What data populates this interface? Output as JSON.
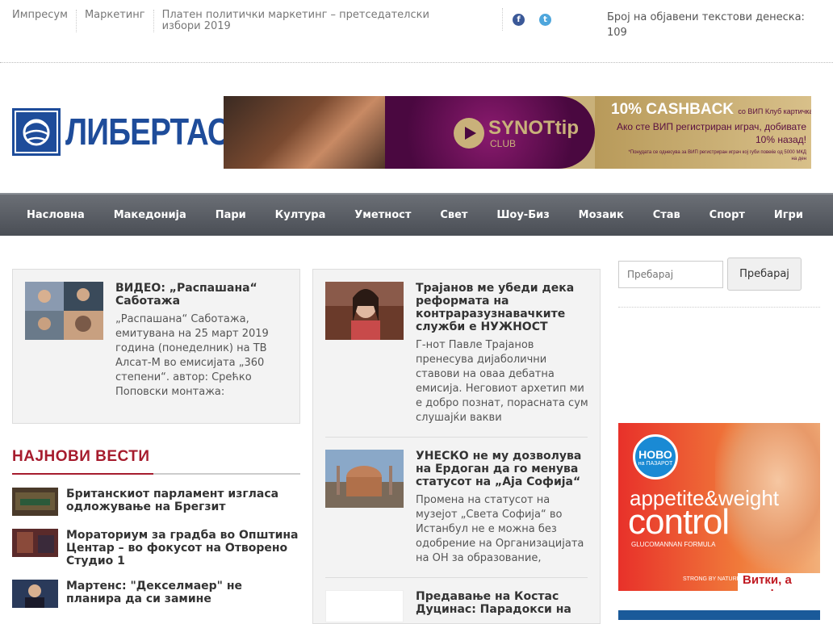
{
  "topbar": {
    "links": [
      "Импресум",
      "Маркетинг",
      "Платен политички маркетинг – претседателски избори 2019"
    ],
    "social": {
      "facebook": "f",
      "twitter": "t"
    },
    "count_label": "Број на објавени текстови денеска:",
    "count_value": "109"
  },
  "logo": {
    "text": "ЛИБЕРТАС"
  },
  "banner": {
    "brand": "SYNOTtip",
    "brand_sub": "CLUB",
    "headline": "10% CASHBACK",
    "headline_sub": "со ВИП Клуб картичка",
    "text": "Ако сте ВИП регистриран играч, добивате 10% назад!",
    "fine_print": "*Понудата се однесува за ВИП регистриран играч кој губи повеќе од 5000 МКД на ден"
  },
  "nav": [
    "Насловна",
    "Македонија",
    "Пари",
    "Култура",
    "Уметност",
    "Свет",
    "Шоу-Биз",
    "Мозаик",
    "Став",
    "Спорт",
    "Игри"
  ],
  "featured": {
    "title": "ВИДЕО: „Распашана“ Саботажа",
    "excerpt": "„Распашана“ Саботажа, емитувана на 25 март 2019 година (понеделник) на ТВ Алсат-М во емисијата „360 степени“. автор: Срећко Поповски монтажа:"
  },
  "latest": {
    "section_title": "НАЈНОВИ ВЕСТИ",
    "items": [
      {
        "title": "Британскиот парламент изгласа одложување на Брегзит"
      },
      {
        "title": "Мораториум за градба во Општина Центар – во фокусот на Отворено Студио 1"
      },
      {
        "title": "Мартенс: \"Декселмаер\" не планира да си замине"
      }
    ]
  },
  "column2": {
    "articles": [
      {
        "title": "Трајанов ме убеди дека реформата на контраразузнавачките служби е НУЖНОСТ",
        "excerpt": "Г-нот Павле Трајанов пренесува дијаболични ставови на оваа дебатна емисија. Неговиот архетип ми е добро познат, порасната сум слушајќи вакви"
      },
      {
        "title": "УНЕСКО не му дозволува на Ердоган да го менува статусот на „Аја Софија“",
        "excerpt": "Промена на статусот на музејот „Света Софија“ во Истанбул не е можна без одобрение на Организацијата на ОН за образование,"
      },
      {
        "title": "Предавање на Костас Дуцинас: Парадокси на",
        "excerpt": ""
      }
    ]
  },
  "search": {
    "placeholder": "Пребарај",
    "button": "Пребарај"
  },
  "ad2": {
    "badge_top": "НОВО",
    "badge_sub": "на ПАЗАРОТ",
    "line1": "appetite&weight",
    "line2": "control",
    "line3": "GLUCOMANNAN FORMULA",
    "brand": "STRONG BY NATURE",
    "slogan": "Витки, а сити!"
  },
  "colors": {
    "brand": "#1e4c9a",
    "section": "#a61c2e",
    "nav": "#5a5e65"
  }
}
